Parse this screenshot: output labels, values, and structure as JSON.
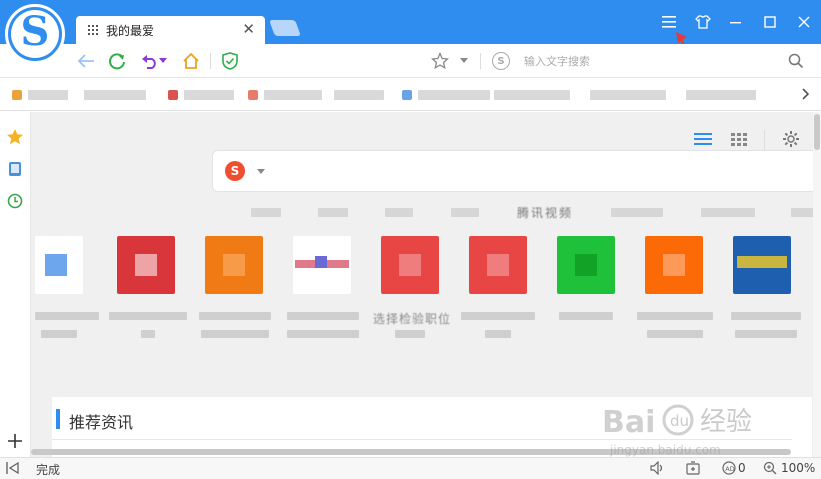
{
  "tab": {
    "title": "我的最爱",
    "close": "✕"
  },
  "window": {
    "menu_icon": "≡",
    "shirt_icon": "skin-icon",
    "min": "—",
    "max": "☐",
    "close": "✕"
  },
  "toolbar": {
    "search_placeholder": "输入文字搜索",
    "search_engine_letter": "S"
  },
  "content": {
    "visible_hotword": "腾讯视频",
    "visible_tile_label": "选择检验职位",
    "news_title": "推荐资讯",
    "sogou_letter": "S"
  },
  "status": {
    "done": "完成",
    "adblock_count": "0",
    "zoom": "100%"
  },
  "watermark": {
    "brand": "Bai@百度",
    "sub": "jingyan.baidu.com",
    "jingyan": "经验"
  },
  "colors": {
    "brand_blue": "#2f8df0",
    "arrow_red": "#e23b3b"
  }
}
